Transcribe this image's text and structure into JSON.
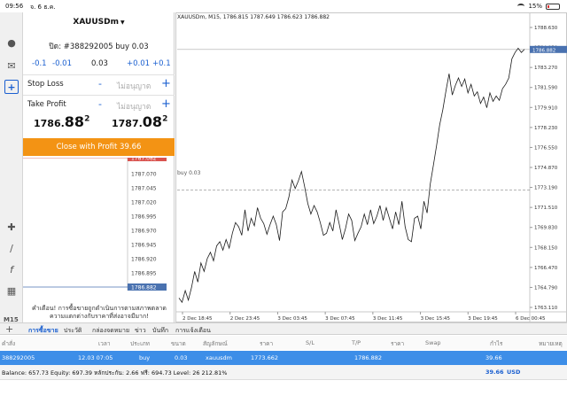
{
  "status_bar": {
    "time": "09:56",
    "date": "จ. 6 ธ.ค.",
    "battery": "15%"
  },
  "sidebar": {
    "icons": [
      "close-icon",
      "account-icon",
      "chat-icon",
      "new-order-icon",
      "crosshair-icon",
      "line-tool-icon",
      "indicator-icon",
      "objects-icon"
    ],
    "timeframe": "M15"
  },
  "order_panel": {
    "symbol": "XAUUSDm",
    "position_info": "ปิด: #388292005 buy 0.03",
    "volume": {
      "minus_big": "-0.1",
      "minus_small": "-0.01",
      "value": "0.03",
      "plus_small": "+0.01",
      "plus_big": "+0.1"
    },
    "stop_loss": {
      "label": "Stop Loss",
      "placeholder": "ไม่อนุญาต"
    },
    "take_profit": {
      "label": "Take Profit",
      "placeholder": "ไม่อนุญาต"
    },
    "bid": {
      "main": "1786.",
      "big": "88",
      "sup": "2"
    },
    "ask": {
      "main": "1787.",
      "big": "08",
      "sup": "2"
    },
    "close_button": "Close with Profit 39.66",
    "mini_ticks": [
      "1787.082",
      "1787.070",
      "1787.045",
      "1787.020",
      "1786.995",
      "1786.970",
      "1786.945",
      "1786.920",
      "1786.895",
      "1786.882"
    ],
    "warning": "คำเตือน! การซื้อขายถูกดำเนินการตามสภาพตลาด ความแตกต่างกับราคาที่ส่งอาจมีมาก!"
  },
  "chart": {
    "title": "XAUUSDm, M15, 1786.815 1787.649 1786.623 1786.882",
    "buy_label": "buy 0.03",
    "colors": {
      "line": "#1a1a1a",
      "current_price": "#4a72b0",
      "grid": "#e8e8e8"
    }
  },
  "chart_data": {
    "type": "line",
    "title": "XAUUSDm, M15, 1786.815 1787.649 1786.623 1786.882",
    "x_ticks": [
      "2 Dec 18:45",
      "2 Dec 23:45",
      "3 Dec 03:45",
      "3 Dec 07:45",
      "3 Dec 11:45",
      "3 Dec 15:45",
      "3 Dec 19:45",
      "6 Dec 00:45"
    ],
    "y_ticks": [
      "1788.630",
      "1784.950",
      "1783.270",
      "1781.590",
      "1779.910",
      "1778.230",
      "1776.550",
      "1774.870",
      "1773.190",
      "1771.510",
      "1769.830",
      "1768.150",
      "1766.470",
      "1764.790",
      "1763.110"
    ],
    "ylim": [
      1762.2,
      1789.2
    ],
    "current_price": 1786.882,
    "buy_price": 1773.662,
    "y": [
      1763.5,
      1763.1,
      1764.2,
      1763.3,
      1764.5,
      1766.0,
      1765.0,
      1766.8,
      1766.0,
      1767.2,
      1767.8,
      1767.0,
      1768.4,
      1768.8,
      1768.0,
      1769.0,
      1768.2,
      1769.6,
      1770.6,
      1770.2,
      1769.4,
      1771.8,
      1769.8,
      1771.0,
      1770.3,
      1772.0,
      1771.0,
      1770.5,
      1769.5,
      1770.4,
      1771.2,
      1770.4,
      1768.9,
      1771.6,
      1771.9,
      1773.0,
      1774.6,
      1773.8,
      1774.5,
      1775.4,
      1774.0,
      1772.4,
      1771.4,
      1772.2,
      1771.6,
      1770.6,
      1769.4,
      1769.6,
      1770.6,
      1769.8,
      1771.8,
      1770.5,
      1769.0,
      1770.0,
      1771.4,
      1770.8,
      1768.9,
      1769.6,
      1770.2,
      1771.4,
      1770.4,
      1771.8,
      1770.5,
      1771.2,
      1772.2,
      1770.8,
      1772.0,
      1771.0,
      1770.0,
      1771.6,
      1770.4,
      1772.6,
      1770.2,
      1769.0,
      1768.8,
      1771.0,
      1771.2,
      1770.0,
      1772.6,
      1771.5,
      1774.2,
      1776.0,
      1777.8,
      1779.8,
      1781.2,
      1783.0,
      1784.6,
      1782.6,
      1783.5,
      1784.2,
      1783.4,
      1784.1,
      1782.8,
      1783.6,
      1782.5,
      1782.9,
      1781.8,
      1782.4,
      1781.4,
      1782.8,
      1782.0,
      1782.5,
      1782.1,
      1783.2,
      1783.6,
      1784.2,
      1786.0,
      1786.6,
      1787.0,
      1786.6,
      1786.9
    ]
  },
  "terminal": {
    "tabs": [
      "การซื้อขาย",
      "ประวัติ",
      "กล่องจดหมาย",
      "ข่าว",
      "บันทึก",
      "การแจ้งเตือน"
    ],
    "columns": [
      "คำสั่ง",
      "เวลา",
      "ประเภท",
      "ขนาด",
      "สัญลักษณ์",
      "ราคา",
      "S/L",
      "T/P",
      "ราคา",
      "Swap",
      "กำไร",
      "หมายเหตุ"
    ],
    "row": [
      "388292005",
      "12.03 07:05",
      "buy",
      "0.03",
      "xauusdm",
      "1773.662",
      "",
      "",
      "1786.882",
      "",
      "39.66",
      ""
    ],
    "footer": {
      "summary": "Balance: 657.73 Equity: 697.39 หลักประกัน: 2.66 ฟรี: 694.73 Level: 26 212.81%",
      "profit": "39.66",
      "currency": "USD"
    }
  }
}
